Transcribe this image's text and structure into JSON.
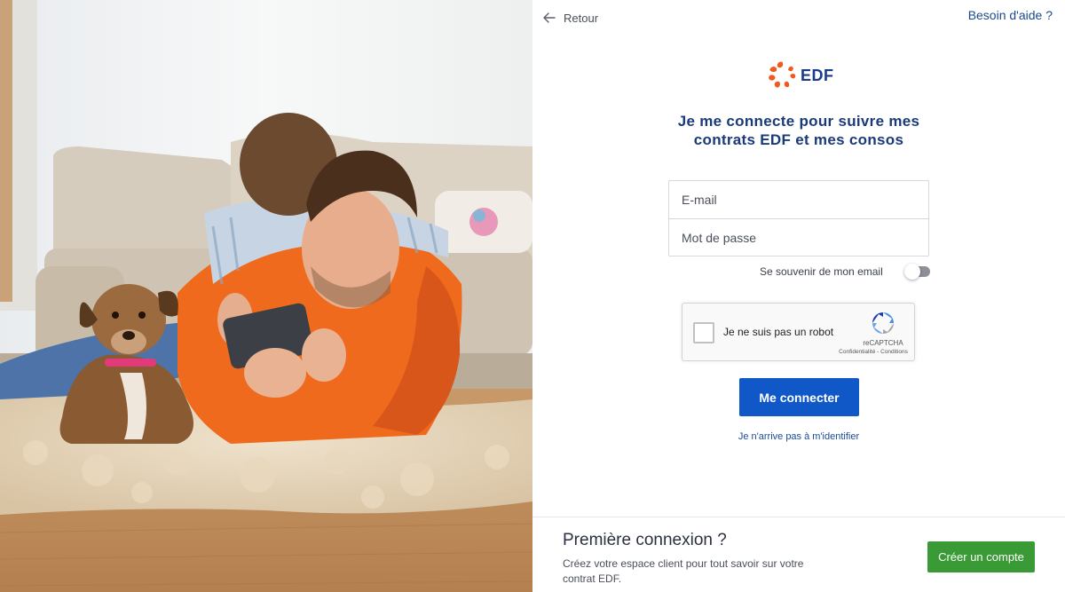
{
  "nav": {
    "back_label": "Retour",
    "help_label": "Besoin d'aide ?"
  },
  "brand": {
    "logo_text": "EDF",
    "primary_color": "#1a3a8c",
    "accent_color": "#f05a1e"
  },
  "login": {
    "title": "Je me connecte pour suivre mes contrats EDF et mes consos",
    "email_placeholder": "E-mail",
    "password_placeholder": "Mot de passe",
    "remember_label": "Se souvenir de mon email",
    "remember_enabled": false,
    "submit_label": "Me connecter",
    "forgot_label": "Je n'arrive pas à m'identifier"
  },
  "captcha": {
    "label": "Je ne suis pas un robot",
    "brand": "reCAPTCHA",
    "terms": "Confidentialité - Conditions",
    "checked": false
  },
  "first_connection": {
    "title": "Première connexion ?",
    "description": "Créez votre espace client pour tout savoir sur votre contrat EDF.",
    "create_label": "Créer un compte",
    "button_color": "#3a9a35"
  },
  "colors": {
    "login_button": "#1057c8"
  }
}
